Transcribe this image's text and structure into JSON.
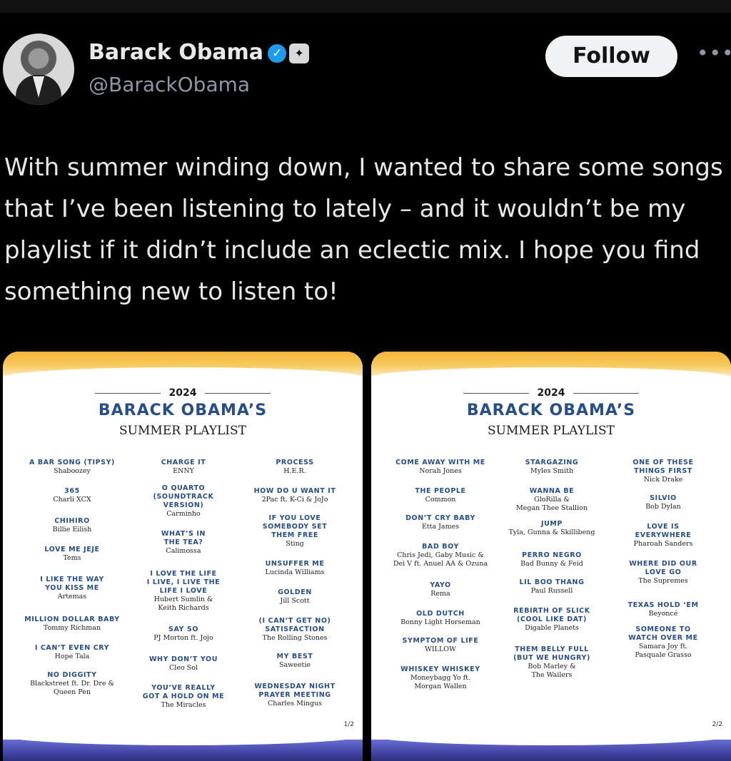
{
  "post": {
    "author_name": "Barack Obama",
    "handle": "@BarackObama",
    "verified_icon": "check",
    "follow_label": "Follow",
    "more_label": "•••",
    "text": "With summer winding down, I wanted to share some songs that I’ve been listening to lately – and it wouldn’t be my playlist if it didn’t include an eclectic mix. I hope you find something new to listen to!"
  },
  "images": [
    {
      "year": "2024",
      "title": "BARACK OBAMA’S",
      "subtitle": "SUMMER PLAYLIST",
      "page": "1/2",
      "columns": [
        [
          {
            "title": "A BAR SONG (TIPSY)",
            "artist": "Shaboozey"
          },
          {
            "title": "365",
            "artist": "Charli XCX"
          },
          {
            "title": "CHIHIRO",
            "artist": "Billie Eilish"
          },
          {
            "title": "LOVE ME JEJE",
            "artist": "Tems"
          },
          {
            "title": "I LIKE THE WAY\nYOU KISS ME",
            "artist": "Artemas"
          },
          {
            "title": "MILLION DOLLAR BABY",
            "artist": "Tommy Richman"
          },
          {
            "title": "I CAN’T EVEN CRY",
            "artist": "Hope Tala"
          },
          {
            "title": "NO DIGGITY",
            "artist": "Blackstreet ft. Dr. Dre &\nQueen Pen"
          }
        ],
        [
          {
            "title": "CHARGE IT",
            "artist": "ENNY"
          },
          {
            "title": "O QUARTO\n(SOUNDTRACK\nVERSION)",
            "artist": "Carminho"
          },
          {
            "title": "WHAT’S IN\nTHE TEA?",
            "artist": "Calimossa"
          },
          {
            "title": "I LOVE THE LIFE\nI LIVE, I LIVE THE\nLIFE I LOVE",
            "artist": "Hubert Sumlin &\nKeith Richards"
          },
          {
            "title": "SAY SO",
            "artist": "PJ Morton ft. Jojo"
          },
          {
            "title": "WHY DON’T YOU",
            "artist": "Cleo Sol"
          },
          {
            "title": "YOU’VE REALLY\nGOT A HOLD ON ME",
            "artist": "The Miracles"
          }
        ],
        [
          {
            "title": "PROCESS",
            "artist": "H.E.R."
          },
          {
            "title": "HOW DO U WANT IT",
            "artist": "2Pac ft. K-Ci & JoJo"
          },
          {
            "title": "IF YOU LOVE\nSOMEBODY SET\nTHEM FREE",
            "artist": "Sting"
          },
          {
            "title": "UNSUFFER ME",
            "artist": "Lucinda Williams"
          },
          {
            "title": "GOLDEN",
            "artist": "Jill Scott"
          },
          {
            "title": "(I CAN’T GET NO)\nSATISFACTION",
            "artist": "The Rolling Stones"
          },
          {
            "title": "MY BEST",
            "artist": "Saweetie"
          },
          {
            "title": "WEDNESDAY NIGHT\nPRAYER MEETING",
            "artist": "Charles Mingus"
          }
        ]
      ]
    },
    {
      "year": "2024",
      "title": "BARACK OBAMA’S",
      "subtitle": "SUMMER PLAYLIST",
      "page": "2/2",
      "columns": [
        [
          {
            "title": "COME AWAY WITH ME",
            "artist": "Norah Jones"
          },
          {
            "title": "THE PEOPLE",
            "artist": "Common"
          },
          {
            "title": "DON’T CRY BABY",
            "artist": "Etta James"
          },
          {
            "title": "BAD BOY",
            "artist": "Chris Jedi, Gaby Music &\nDei V ft. Anuel AA & Ozuna"
          },
          {
            "title": "YAYO",
            "artist": "Rema"
          },
          {
            "title": "OLD DUTCH",
            "artist": "Bonny Light Horseman"
          },
          {
            "title": "SYMPTOM OF LIFE",
            "artist": "WILLOW"
          },
          {
            "title": "WHISKEY WHISKEY",
            "artist": "Moneybagg Yo ft.\nMorgan Wallen"
          }
        ],
        [
          {
            "title": "STARGAZING",
            "artist": "Myles Smith"
          },
          {
            "title": "WANNA BE",
            "artist": "GloRilla &\nMegan Thee Stallion"
          },
          {
            "title": "JUMP",
            "artist": "Tyla, Gunna & Skillibeng"
          },
          {
            "title": "PERRO NEGRO",
            "artist": "Bad Bunny & Feid"
          },
          {
            "title": "LIL BOO THANG",
            "artist": "Paul Russell"
          },
          {
            "title": "REBIRTH OF SLICK\n(COOL LIKE DAT)",
            "artist": "Digable Planets"
          },
          {
            "title": "THEM BELLY FULL\n(BUT WE HUNGRY)",
            "artist": "Bob Marley &\nThe Wailers"
          }
        ],
        [
          {
            "title": "ONE OF THESE\nTHINGS FIRST",
            "artist": "Nick Drake"
          },
          {
            "title": "SILVIO",
            "artist": "Bob Dylan"
          },
          {
            "title": "LOVE IS\nEVERYWHERE",
            "artist": "Pharoah Sanders"
          },
          {
            "title": "WHERE DID OUR\nLOVE GO",
            "artist": "The Supremes"
          },
          {
            "title": "TEXAS HOLD ‘EM",
            "artist": "Beyoncé"
          },
          {
            "title": "SOMEONE TO\nWATCH OVER ME",
            "artist": "Samara Joy ft.\nPasquale Grasso"
          }
        ]
      ]
    }
  ]
}
